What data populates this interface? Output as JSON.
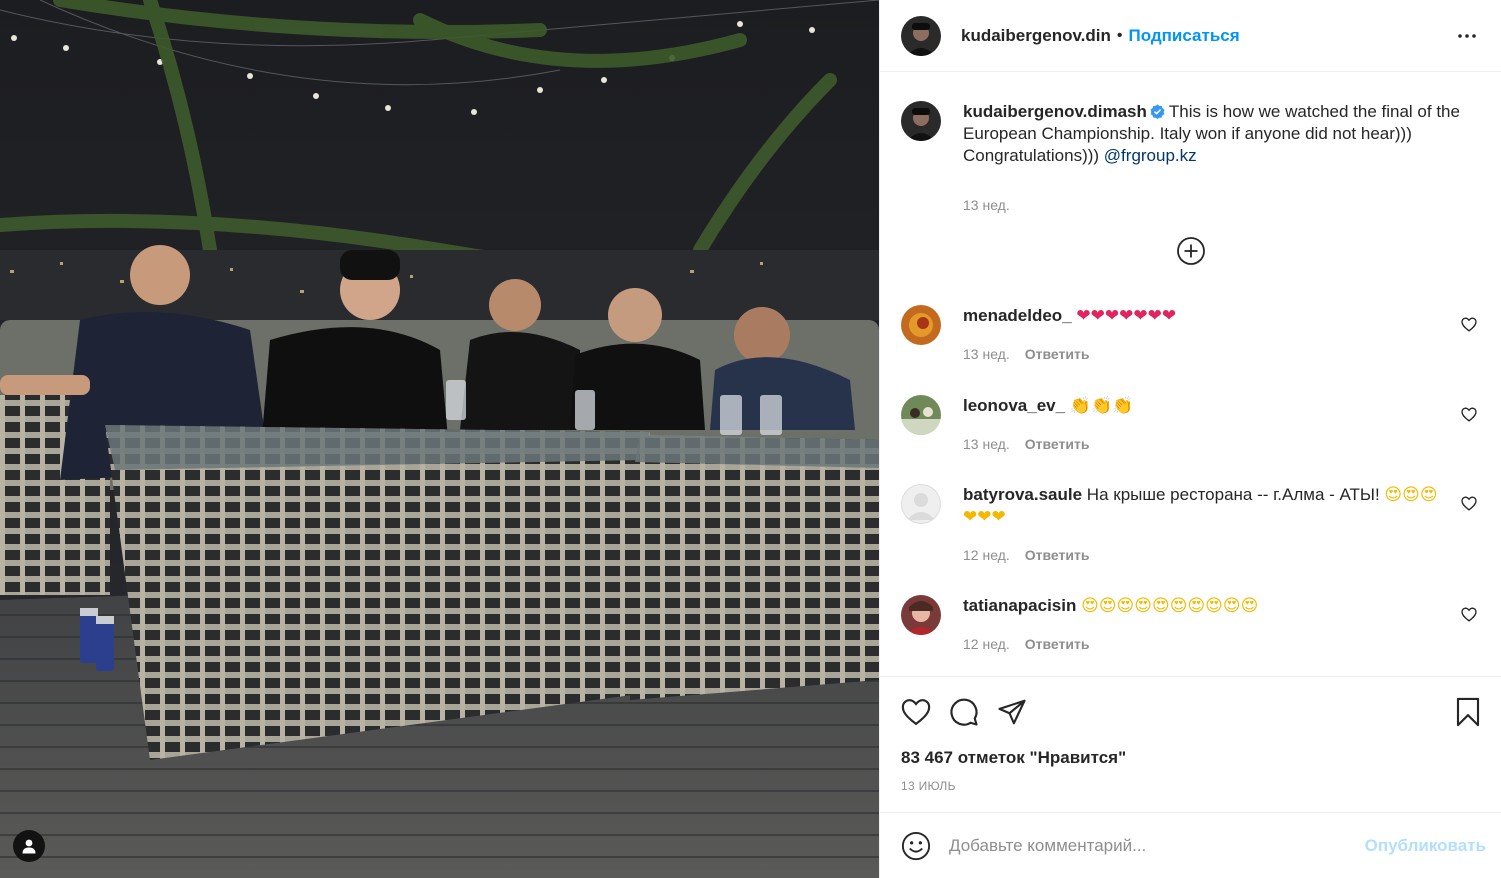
{
  "post": {
    "author": "kudaibergenov.din",
    "follow_label": "Подписаться",
    "dot": "•"
  },
  "caption": {
    "username": "kudaibergenov.dimash",
    "text": "This is how we watched the final of the European Championship. Italy won if anyone did not hear))) Congratulations)))",
    "mention": "@frgroup.kz",
    "time": "13 нед."
  },
  "comments": [
    {
      "username": "menadeldeo_",
      "text": "",
      "emoji": "❤❤❤❤❤❤❤",
      "time": "13 нед.",
      "reply": "Ответить"
    },
    {
      "username": "leonova_ev_",
      "text": "",
      "emoji": "👏👏👏",
      "time": "13 нед.",
      "reply": "Ответить"
    },
    {
      "username": "batyrova.saule",
      "text": "На крыше ресторана -- г.Алма - АТЫ!",
      "emoji": "😍😍😍❤❤❤",
      "time": "12 нед.",
      "reply": "Ответить"
    },
    {
      "username": "tatianapacisin",
      "text": "",
      "emoji": "😍😍😍😍😍😍😍😍😍😍",
      "time": "12 нед.",
      "reply": "Ответить"
    }
  ],
  "footer": {
    "likes": "83 467 отметок \"Нравится\"",
    "date": "13 июль"
  },
  "compose": {
    "placeholder": "Добавьте комментарий...",
    "post_label": "Опубликовать"
  },
  "icons": {
    "like": "heart-icon",
    "comment": "comment-icon",
    "share": "share-icon",
    "save": "bookmark-icon",
    "more": "more-options-icon",
    "load_more": "plus-circle-icon",
    "emoji": "emoji-icon",
    "user_tags": "user-icon",
    "verified": "verified-badge-icon"
  },
  "colors": {
    "link_blue": "#0095f6",
    "mention": "#00376b",
    "muted": "#8e8e8e",
    "post_disabled": "#b2dffc",
    "verified": "#3897f0"
  }
}
